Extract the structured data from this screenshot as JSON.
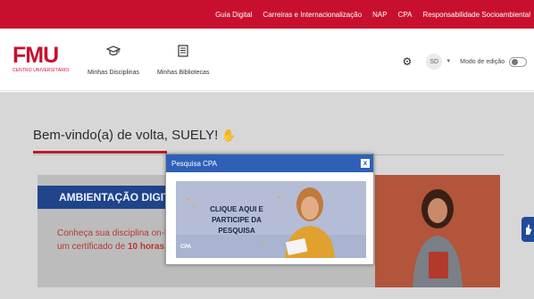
{
  "topbar": {
    "links": [
      "Guia Digital",
      "Carreiras e Internacionalização",
      "NAP",
      "CPA",
      "Responsabilidade Socioambiental"
    ]
  },
  "header": {
    "logo_main": "FMU",
    "logo_sub": "CENTRO UNIVERSITÁRIO",
    "nav": [
      {
        "label": "Minhas Disciplinas",
        "icon": "graduation-cap-icon"
      },
      {
        "label": "Minhas Bibliotecas",
        "icon": "book-icon"
      }
    ],
    "avatar_initials": "SD",
    "edit_mode_label": "Modo de edição"
  },
  "main": {
    "welcome": "Bem-vindo(a) de volta, SUELY!",
    "banner": {
      "title": "AMBIENTAÇÃO DIGITA",
      "line1": "Conheça sua disciplina on-l",
      "line2_prefix": "um certificado de",
      "line2_bold": "10 horas"
    }
  },
  "modal": {
    "title": "Pesquisa CPA",
    "close": "x",
    "promo_text": "CLIQUE AQUI E PARTICIPE DA PESQUISA",
    "promo_logo": "CPA"
  },
  "colors": {
    "brand_red": "#c8102e",
    "modal_blue": "#2f60b8",
    "banner_blue": "#20448a"
  }
}
